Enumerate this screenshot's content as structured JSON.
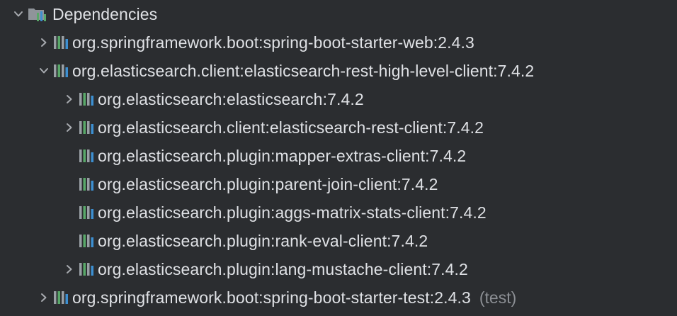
{
  "tree": {
    "root": {
      "label": "Dependencies",
      "icon": "dependencies-folder-icon",
      "expanded": true
    },
    "items": [
      {
        "label": "org.springframework.boot:spring-boot-starter-web:2.4.3",
        "chevron": "collapsed",
        "icon": "library-icon"
      },
      {
        "label": "org.elasticsearch.client:elasticsearch-rest-high-level-client:7.4.2",
        "chevron": "expanded",
        "icon": "library-icon"
      },
      {
        "label": "org.elasticsearch:elasticsearch:7.4.2",
        "chevron": "collapsed",
        "icon": "library-icon"
      },
      {
        "label": "org.elasticsearch.client:elasticsearch-rest-client:7.4.2",
        "chevron": "collapsed",
        "icon": "library-icon"
      },
      {
        "label": "org.elasticsearch.plugin:mapper-extras-client:7.4.2",
        "chevron": "none",
        "icon": "library-icon"
      },
      {
        "label": "org.elasticsearch.plugin:parent-join-client:7.4.2",
        "chevron": "none",
        "icon": "library-icon"
      },
      {
        "label": "org.elasticsearch.plugin:aggs-matrix-stats-client:7.4.2",
        "chevron": "none",
        "icon": "library-icon"
      },
      {
        "label": "org.elasticsearch.plugin:rank-eval-client:7.4.2",
        "chevron": "none",
        "icon": "library-icon"
      },
      {
        "label": "org.elasticsearch.plugin:lang-mustache-client:7.4.2",
        "chevron": "collapsed",
        "icon": "library-icon"
      },
      {
        "label": "org.springframework.boot:spring-boot-starter-test:2.4.3",
        "suffix": "(test)",
        "chevron": "collapsed",
        "icon": "library-icon"
      }
    ]
  },
  "colors": {
    "background": "#2b2d30",
    "text": "#dfe1e5",
    "muted": "#8c8f94",
    "chevron": "#a8abb0",
    "icon_bar_gray": "#9aa0a6",
    "icon_bar_green": "#59a869",
    "icon_bar_blue": "#3d8fd1"
  }
}
